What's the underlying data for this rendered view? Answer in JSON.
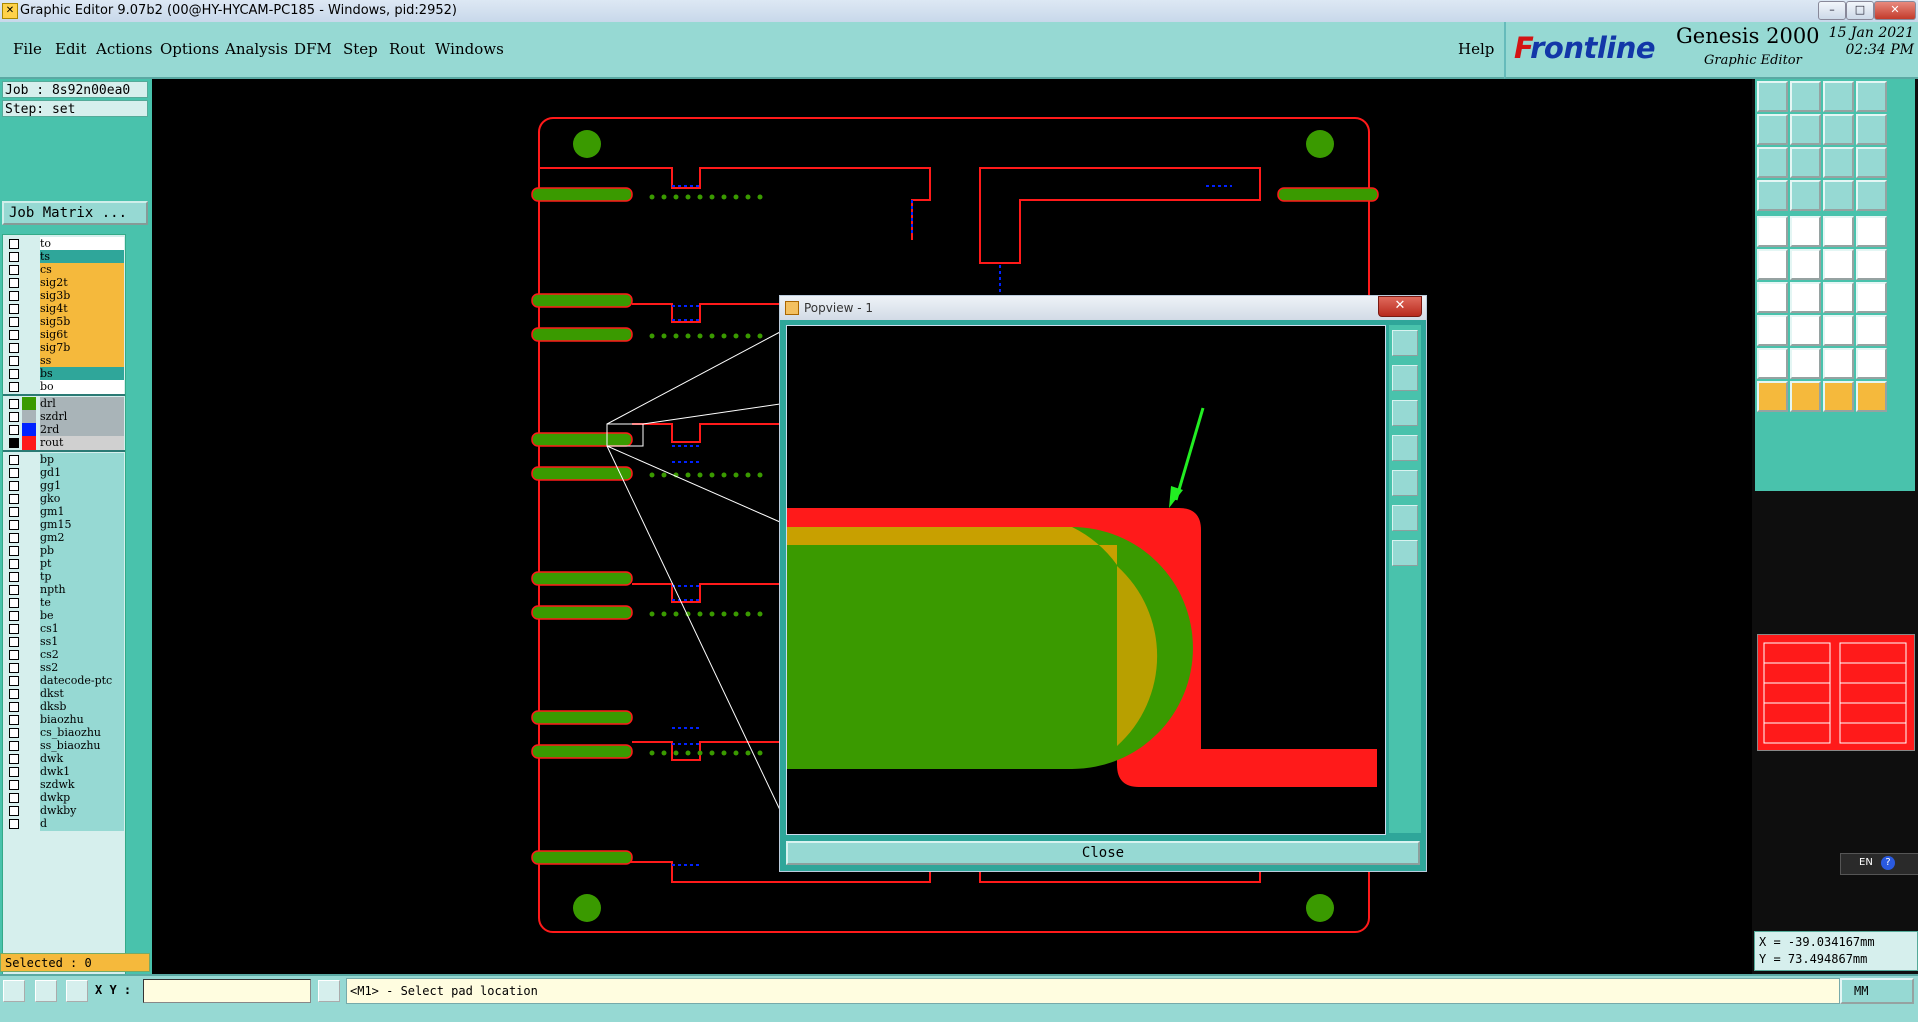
{
  "window": {
    "title": "Graphic Editor 9.07b2 (00@HY-HYCAM-PC185 - Windows, pid:2952)",
    "buttons": [
      "–",
      "□",
      "✕"
    ]
  },
  "menu": {
    "items": [
      "File",
      "Edit",
      "Actions",
      "Options",
      "Analysis",
      "DFM",
      "Step",
      "Rout",
      "Windows"
    ],
    "help": "Help"
  },
  "brand": {
    "logo_first": "F",
    "logo_rest": "rontline",
    "product": "Genesis 2000",
    "subtitle": "Graphic Editor",
    "date": "15 Jan 2021",
    "time": "02:34 PM"
  },
  "left_panel": {
    "job": "Job : 8s92n00ea0",
    "step": "Step: set",
    "job_matrix": "Job Matrix ...",
    "selected": "Selected : 0"
  },
  "layers": {
    "board": [
      {
        "name": "to",
        "bg": "#ffffff"
      },
      {
        "name": "ts",
        "bg": "#2fa69a"
      },
      {
        "name": "cs",
        "bg": "#f5b93c"
      },
      {
        "name": "sig2t",
        "bg": "#f5b93c"
      },
      {
        "name": "sig3b",
        "bg": "#f5b93c"
      },
      {
        "name": "sig4t",
        "bg": "#f5b93c"
      },
      {
        "name": "sig5b",
        "bg": "#f5b93c"
      },
      {
        "name": "sig6t",
        "bg": "#f5b93c"
      },
      {
        "name": "sig7b",
        "bg": "#f5b93c"
      },
      {
        "name": "ss",
        "bg": "#f5b93c"
      },
      {
        "name": "bs",
        "bg": "#2fa69a"
      },
      {
        "name": "bo",
        "bg": "#ffffff"
      }
    ],
    "drill": [
      {
        "name": "drl",
        "bg": "#a9b4b8",
        "color": "#3a9a00",
        "checked": false
      },
      {
        "name": "szdrl",
        "bg": "#a9b4b8",
        "color": "#a9b4b8",
        "checked": false
      },
      {
        "name": "2rd",
        "bg": "#a9b4b8",
        "color": "#0022ff",
        "checked": false
      },
      {
        "name": "rout",
        "bg": "#d0d0d0",
        "color": "#ff1a1a",
        "checked": true
      }
    ],
    "misc": [
      "bp",
      "gd1",
      "gg1",
      "gko",
      "gm1",
      "gm15",
      "gm2",
      "pb",
      "pt",
      "tp",
      "npth",
      "te",
      "be",
      "cs1",
      "ss1",
      "cs2",
      "ss2",
      "datecode-ptc",
      "dkst",
      "dksb",
      "biaozhu",
      "cs_biaozhu",
      "ss_biaozhu",
      "dwk",
      "dwk1",
      "szdwk",
      "dwkp",
      "dwkby",
      "d"
    ],
    "misc_bg": "#96d9d3"
  },
  "popview": {
    "title": "Popview - 1",
    "close_label": "Close"
  },
  "coords": {
    "x": "X = -39.034167mm",
    "y": "Y = 73.494867mm"
  },
  "lang": "EN",
  "bottom": {
    "xy_label": "X Y :",
    "status": "<M1> - Select pad location",
    "units": "MM"
  },
  "colors": {
    "teal": "#96d9d3",
    "panel": "#49c2ac",
    "rout": "#ff1a1a",
    "pad": "#3a9a00",
    "via": "#0022ff"
  }
}
